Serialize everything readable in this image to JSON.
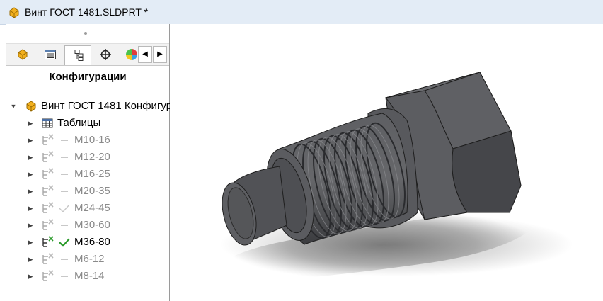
{
  "window": {
    "title": "Винт ГОСТ 1481.SLDPRT *"
  },
  "panel": {
    "heading": "Конфигурации",
    "tabs": [
      "part-icon",
      "feature-list-icon",
      "configuration-icon",
      "crosshair-icon",
      "appearance-icon"
    ],
    "scroll_left": "◀",
    "scroll_right": "▶",
    "tree": {
      "root_label": "Винт ГОСТ 1481 Конфигур",
      "tables_label": "Таблицы",
      "configs": [
        {
          "label": "M10-16",
          "state": "inactive"
        },
        {
          "label": "M12-20",
          "state": "inactive"
        },
        {
          "label": "M16-25",
          "state": "inactive"
        },
        {
          "label": "M20-35",
          "state": "inactive"
        },
        {
          "label": "M24-45",
          "state": "inactive-checked"
        },
        {
          "label": "M30-60",
          "state": "inactive"
        },
        {
          "label": "M36-80",
          "state": "active"
        },
        {
          "label": "M6-12",
          "state": "inactive"
        },
        {
          "label": "M8-14",
          "state": "inactive"
        }
      ]
    }
  },
  "colors": {
    "titlebar": "#e3ecf6",
    "active_check": "#2a9a2a",
    "model_body": "#5a5b5e"
  }
}
